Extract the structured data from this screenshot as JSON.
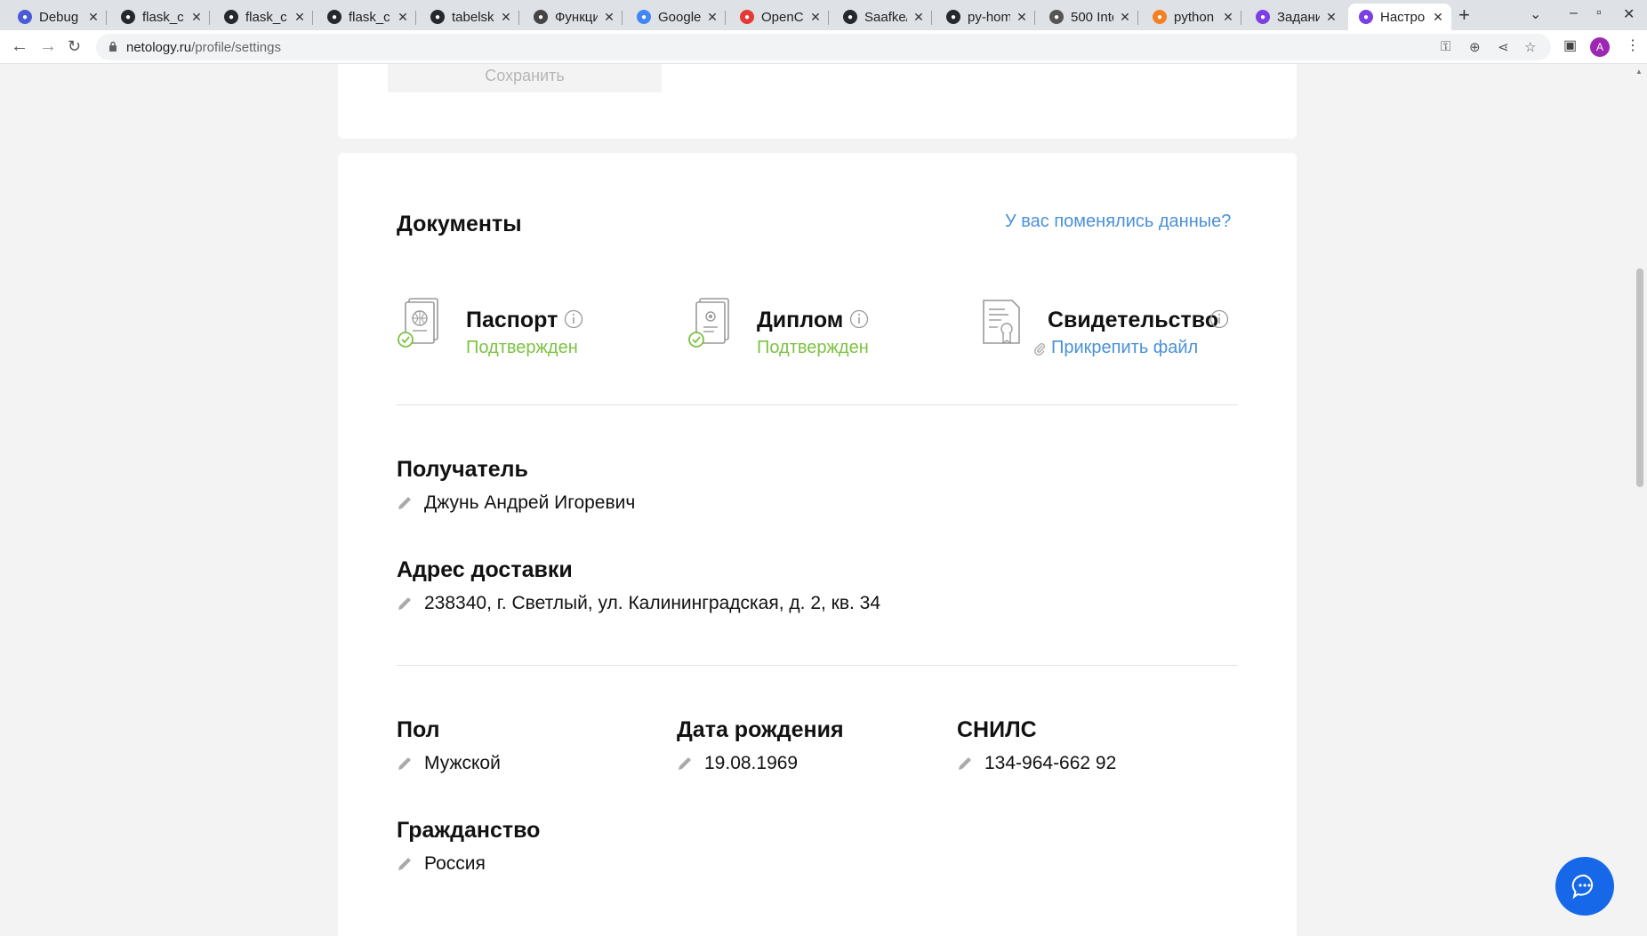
{
  "browser": {
    "tabs": [
      {
        "title": "Debug",
        "color": "#4b5bd6"
      },
      {
        "title": "flask_c",
        "color": "#24292e"
      },
      {
        "title": "flask_c",
        "color": "#24292e"
      },
      {
        "title": "flask_c",
        "color": "#24292e"
      },
      {
        "title": "tabelsk",
        "color": "#24292e"
      },
      {
        "title": "Функци",
        "color": "#444444"
      },
      {
        "title": "Google",
        "color": "#4285f4"
      },
      {
        "title": "OpenC",
        "color": "#e53935"
      },
      {
        "title": "Saafke/",
        "color": "#24292e"
      },
      {
        "title": "py-hom",
        "color": "#24292e"
      },
      {
        "title": "500 Inte",
        "color": "#555555"
      },
      {
        "title": "python",
        "color": "#f48024"
      },
      {
        "title": "Задани",
        "color": "#7b3fe4"
      },
      {
        "title": "Настро",
        "color": "#7b3fe4"
      }
    ],
    "url_host": "netology.ru",
    "url_path": "/profile/settings",
    "avatar_letter": "A"
  },
  "page": {
    "save_button": "Сохранить",
    "documents": {
      "heading": "Документы",
      "changed_link": "У вас поменялись данные?",
      "items": [
        {
          "title": "Паспорт",
          "status": "Подтвержден"
        },
        {
          "title": "Диплом",
          "status": "Подтвержден"
        },
        {
          "title": "Свидетельство",
          "action": "Прикрепить файл"
        }
      ]
    },
    "recipient": {
      "label": "Получатель",
      "value": "Джунь Андрей Игоревич"
    },
    "address": {
      "label": "Адрес доставки",
      "value": "238340, г. Светлый, ул. Калининградская, д. 2, кв. 34"
    },
    "gender": {
      "label": "Пол",
      "value": "Мужской"
    },
    "birthdate": {
      "label": "Дата рождения",
      "value": "19.08.1969"
    },
    "snils": {
      "label": "СНИЛС",
      "value": "134-964-662 92"
    },
    "citizenship": {
      "label": "Гражданство",
      "value": "Россия"
    }
  },
  "colors": {
    "confirmed": "#7cc242",
    "link": "#4a90d9",
    "chat_button": "#1668e8"
  },
  "icons": [
    "passport-icon",
    "diploma-icon",
    "certificate-icon",
    "info-icon",
    "check-circle-icon",
    "paperclip-icon",
    "pencil-icon",
    "chat-icon"
  ]
}
